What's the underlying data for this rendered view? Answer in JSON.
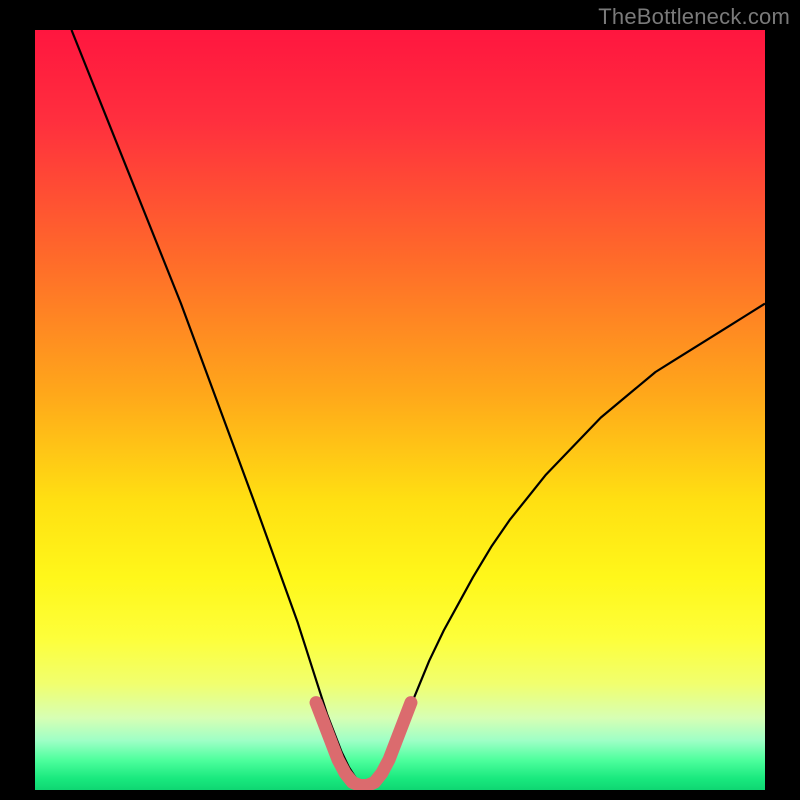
{
  "watermark": "TheBottleneck.com",
  "chart_data": {
    "type": "line",
    "title": "",
    "xlabel": "",
    "ylabel": "",
    "xlim": [
      0,
      100
    ],
    "ylim": [
      0,
      100
    ],
    "background_gradient": {
      "stops": [
        {
          "offset": 0.0,
          "color": "#ff163f"
        },
        {
          "offset": 0.12,
          "color": "#ff2f3e"
        },
        {
          "offset": 0.3,
          "color": "#ff6a2a"
        },
        {
          "offset": 0.48,
          "color": "#ffa81a"
        },
        {
          "offset": 0.62,
          "color": "#ffe012"
        },
        {
          "offset": 0.72,
          "color": "#fff71a"
        },
        {
          "offset": 0.8,
          "color": "#fdff3a"
        },
        {
          "offset": 0.86,
          "color": "#f1ff6e"
        },
        {
          "offset": 0.905,
          "color": "#d7ffb4"
        },
        {
          "offset": 0.935,
          "color": "#9effc6"
        },
        {
          "offset": 0.96,
          "color": "#4fff9e"
        },
        {
          "offset": 0.985,
          "color": "#19e97e"
        },
        {
          "offset": 1.0,
          "color": "#0fd672"
        }
      ]
    },
    "series": [
      {
        "name": "bottleneck-curve",
        "color": "#000000",
        "stroke_width": 2.2,
        "x": [
          5.0,
          7.5,
          10.0,
          12.5,
          15.0,
          17.5,
          20.0,
          22.5,
          25.0,
          27.5,
          30.0,
          31.5,
          33.0,
          34.5,
          36.0,
          37.0,
          38.0,
          39.0,
          40.0,
          41.0,
          42.0,
          43.0,
          44.0,
          45.0,
          46.0,
          47.0,
          48.0,
          49.0,
          50.0,
          51.0,
          52.5,
          54.0,
          56.0,
          58.0,
          60.0,
          62.5,
          65.0,
          67.5,
          70.0,
          72.5,
          75.0,
          77.5,
          80.0,
          82.5,
          85.0,
          87.5,
          90.0,
          92.5,
          95.0,
          97.5,
          100.0
        ],
        "y": [
          100.0,
          94.0,
          88.0,
          82.0,
          76.0,
          70.0,
          64.0,
          57.5,
          51.0,
          44.5,
          38.0,
          34.0,
          30.0,
          26.0,
          22.0,
          19.0,
          16.0,
          13.0,
          10.0,
          7.5,
          5.0,
          3.0,
          1.5,
          0.6,
          0.6,
          1.5,
          3.0,
          5.0,
          7.5,
          10.0,
          13.5,
          17.0,
          21.0,
          24.5,
          28.0,
          32.0,
          35.5,
          38.5,
          41.5,
          44.0,
          46.5,
          49.0,
          51.0,
          53.0,
          55.0,
          56.5,
          58.0,
          59.5,
          61.0,
          62.5,
          64.0
        ]
      },
      {
        "name": "optimal-zone-marker",
        "color": "#db6b6e",
        "stroke_width": 13,
        "linecap": "round",
        "x": [
          38.5,
          39.5,
          40.5,
          41.5,
          42.5,
          43.5,
          44.5,
          45.5,
          46.5,
          47.5,
          48.5,
          49.5,
          50.5,
          51.5
        ],
        "y": [
          11.5,
          9.0,
          6.5,
          4.0,
          2.2,
          1.0,
          0.6,
          0.6,
          1.0,
          2.2,
          4.0,
          6.5,
          9.0,
          11.5
        ]
      }
    ]
  }
}
